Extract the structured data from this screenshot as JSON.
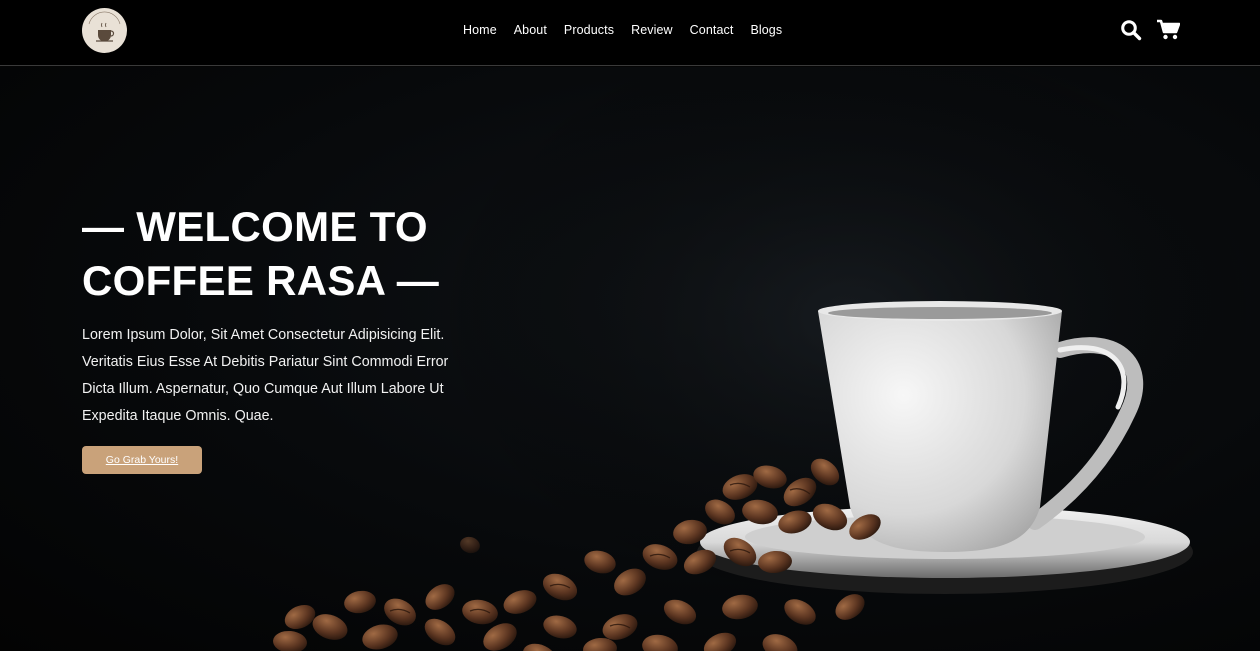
{
  "brand": {
    "logo_icon": "coffee-rasa-logo",
    "logo_text": "COFFEE RASA"
  },
  "nav": {
    "items": [
      {
        "label": "Home"
      },
      {
        "label": "About"
      },
      {
        "label": "Products"
      },
      {
        "label": "Review"
      },
      {
        "label": "Contact"
      },
      {
        "label": "Blogs"
      }
    ]
  },
  "header_icons": {
    "search": "search-icon",
    "cart": "shopping-cart-icon"
  },
  "hero": {
    "title_line1": "— WELCOME TO",
    "title_line2": "COFFEE RASA —",
    "description": "Lorem Ipsum Dolor, Sit Amet Consectetur Adipisicing Elit. Veritatis Eius Esse At Debitis Pariatur Sint Commodi Error Dicta Illum. Aspernatur, Quo Cumque Aut Illum Labore Ut Expedita Itaque Omnis. Quae.",
    "cta_label": "Go Grab Yours!",
    "image": "coffee-cup-with-beans-photo"
  },
  "colors": {
    "accent": "#c9a27a",
    "header_bg": "#000000",
    "hero_bg": "#050505",
    "logo_bg": "#e9e1d6"
  }
}
